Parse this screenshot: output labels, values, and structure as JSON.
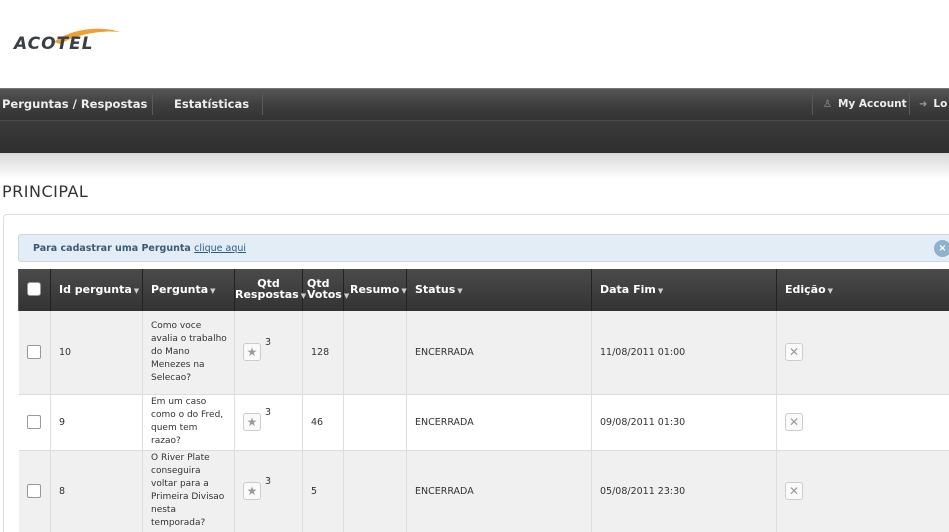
{
  "brand": {
    "logo_text": "ACOTEL",
    "accent": "#f0a030"
  },
  "nav": {
    "items": [
      {
        "label": "Perguntas / Respostas"
      },
      {
        "label": "Estatísticas"
      }
    ],
    "account_label": "My Account",
    "logout_label": "Lo"
  },
  "page": {
    "title": "PRINCIPAL"
  },
  "notice": {
    "text": "Para cadastrar uma Pergunta",
    "link": "clique aqui",
    "close": "×"
  },
  "table": {
    "headers": {
      "id": "Id pergunta",
      "pergunta": "Pergunta",
      "qtd_resp_1": "Qtd",
      "qtd_resp_2": "Respostas",
      "qtd_votos_1": "Qtd",
      "qtd_votos_2": "Votos",
      "resumo": "Resumo",
      "status": "Status",
      "data_fim": "Data Fim",
      "edicao": "Edição"
    },
    "rows": [
      {
        "id": "10",
        "pergunta": "Como voce avalia o trabalho do Mano Menezes na Selecao?",
        "respostas": "3",
        "votos": "128",
        "resumo": "",
        "status": "ENCERRADA",
        "data_fim": "11/08/2011 01:00"
      },
      {
        "id": "9",
        "pergunta": "Em um caso como o do Fred, quem tem razao?",
        "respostas": "3",
        "votos": "46",
        "resumo": "",
        "status": "ENCERRADA",
        "data_fim": "09/08/2011 01:30"
      },
      {
        "id": "8",
        "pergunta": "O River Plate conseguira voltar para a Primeira Divisao nesta temporada?",
        "respostas": "3",
        "votos": "5",
        "resumo": "",
        "status": "ENCERRADA",
        "data_fim": "05/08/2011 23:30"
      }
    ]
  }
}
